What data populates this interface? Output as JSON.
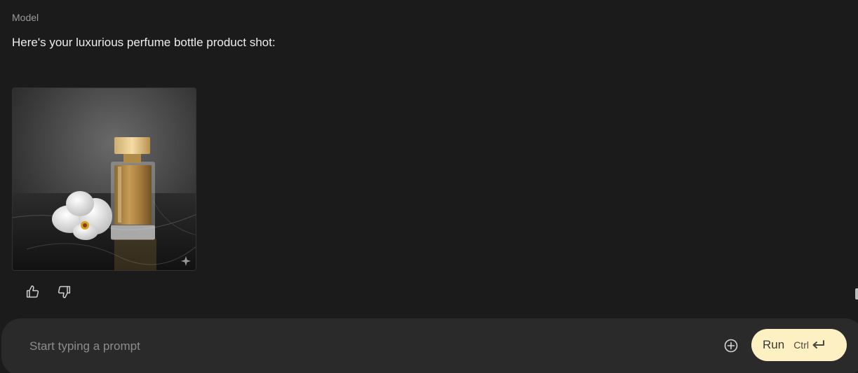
{
  "message": {
    "role": "Model",
    "text": "Here's your luxurious perfume bottle product shot:"
  },
  "image": {
    "subject": "perfume bottle with white orchid on marble",
    "badge_icon": "sparkle-icon"
  },
  "feedback": {
    "like_icon": "thumbs-up-icon",
    "dislike_icon": "thumbs-down-icon"
  },
  "prompt": {
    "placeholder": "Start typing a prompt",
    "value": "",
    "add_icon": "add-circle-icon",
    "run_label": "Run",
    "shortcut_label": "Ctrl",
    "shortcut_icon": "enter-key-icon"
  },
  "colors": {
    "background": "#1b1b1b",
    "prompt_bar": "#2a2a2a",
    "run_button": "#fdf1c4"
  }
}
